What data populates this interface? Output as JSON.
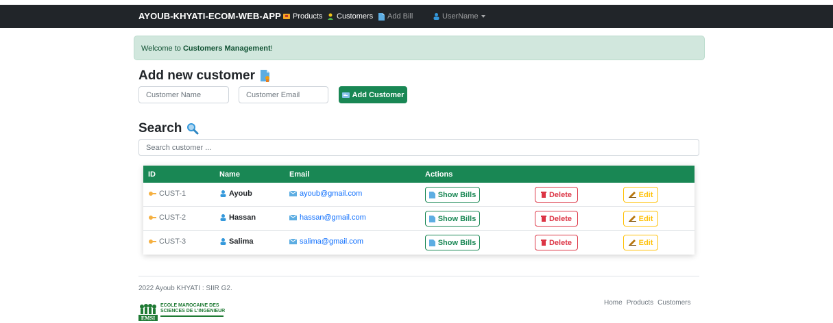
{
  "navbar": {
    "brand": "AYOUB-KHYATI-ECOM-WEB-APP",
    "products": "Products",
    "customers": "Customers",
    "add_bill": "Add Bill",
    "user": "UserName"
  },
  "alert": {
    "prefix": "Welcome to ",
    "strong": "Customers Management",
    "suffix": "!"
  },
  "add_section": {
    "title": "Add new customer",
    "name_placeholder": "Customer Name",
    "email_placeholder": "Customer Email",
    "button_label": "Add Customer"
  },
  "search_section": {
    "title": "Search",
    "placeholder": "Search customer ..."
  },
  "table": {
    "headers": [
      "ID",
      "Name",
      "Email",
      "Actions"
    ],
    "rows": [
      {
        "id": "CUST-1",
        "name": "Ayoub",
        "email": "ayoub@gmail.com"
      },
      {
        "id": "CUST-2",
        "name": "Hassan",
        "email": "hassan@gmail.com"
      },
      {
        "id": "CUST-3",
        "name": "Salima",
        "email": "salima@gmail.com"
      }
    ],
    "actions": {
      "show_bills": "Show Bills",
      "delete": "Delete",
      "edit": "Edit"
    }
  },
  "footer": {
    "copyright": "2022 Ayoub KHYATI : SIIR G2.",
    "links": [
      "Home",
      "Products",
      "Customers"
    ],
    "logo_line1": "ECOLE MAROCAINE DES",
    "logo_line2": "SCIENCES DE L'INGENIEUR",
    "logo_mark": "EMSI"
  },
  "colors": {
    "primary": "#198754",
    "danger": "#dc3545",
    "warning": "#ffc107",
    "navbar": "#212529",
    "alert_bg": "#d1e7dd"
  }
}
